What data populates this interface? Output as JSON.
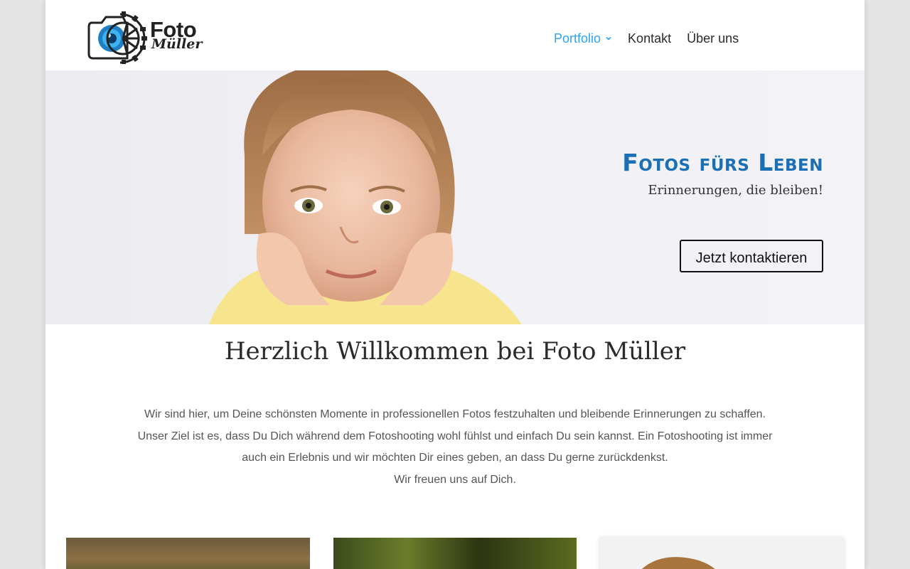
{
  "brand": {
    "name": "Foto",
    "sub": "Müller"
  },
  "nav": {
    "items": [
      {
        "label": "Portfolio",
        "active": true,
        "has_dropdown": true
      },
      {
        "label": "Kontakt",
        "active": false,
        "has_dropdown": false
      },
      {
        "label": "Über uns",
        "active": false,
        "has_dropdown": false
      }
    ]
  },
  "hero": {
    "title": "Fotos fürs Leben",
    "subtitle": "Erinnerungen, die bleiben!",
    "cta": "Jetzt kontaktieren"
  },
  "welcome": {
    "title": "Herzlich Willkommen bei Foto Müller",
    "lines": [
      "Wir sind hier, um Deine schönsten Momente in professionellen Fotos festzuhalten und bleibende Erinnerungen zu schaffen.",
      "Unser Ziel ist es, dass Du Dich während dem Fotoshooting wohl fühlst und einfach Du sein kannst. Ein Fotoshooting ist immer",
      "auch ein Erlebnis und wir möchten Dir eines geben, an dass Du gerne zurückdenkst.",
      "Wir freuen uns auf Dich."
    ]
  },
  "colors": {
    "accent": "#2ea3f2",
    "hero_title": "#1b6fb4",
    "text": "#555555",
    "heading": "#2a2a2a"
  },
  "icons": {
    "logo": "camera-gear-icon",
    "dropdown": "chevron-down-icon"
  }
}
